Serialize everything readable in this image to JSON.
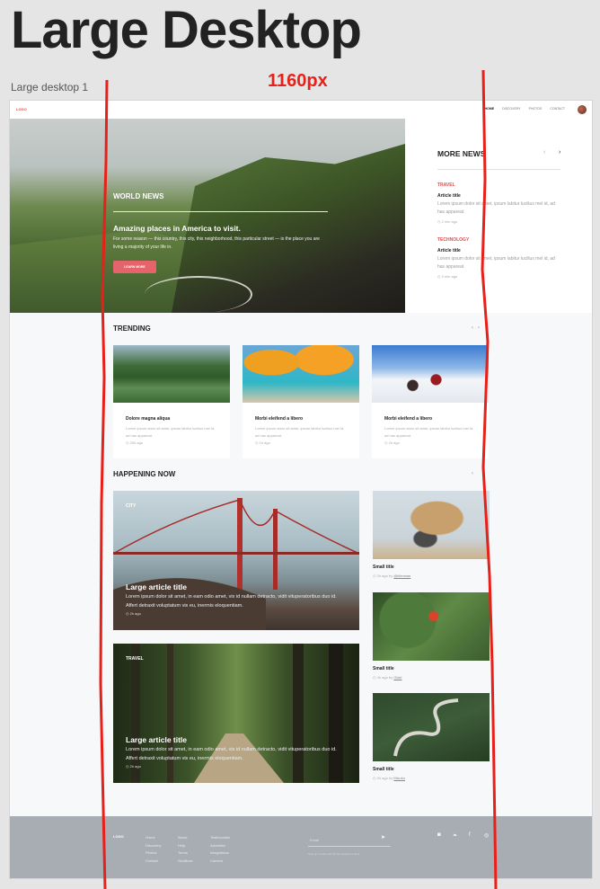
{
  "header": {
    "title": "Large Desktop",
    "frame_label": "Large desktop 1",
    "width_label": "1160px"
  },
  "colors": {
    "accent": "#e5636b",
    "annotation": "#e8201a",
    "footer_bg": "#a8adb4"
  },
  "nav": {
    "logo": "LOGO",
    "links": [
      "HOME",
      "DISCOVERY",
      "PHOTOS",
      "CONTACT"
    ],
    "active": "HOME"
  },
  "hero": {
    "label": "WORLD NEWS",
    "title": "Amazing places in America to visit.",
    "text": "For some reason — this country, this city, this neighborhood, this particular street — is the place you are living a majority of your life in.",
    "button": "LEARN MORE"
  },
  "more_news": {
    "title": "MORE NEWS",
    "items": [
      {
        "category": "TRAVEL",
        "title": "Article title",
        "text": "Lorem ipsum dolor sit amet, ipsum labitur lucilius mel id, ad has appareat.",
        "time": "2 min ago"
      },
      {
        "category": "TECHNOLOGY",
        "title": "Article title",
        "text": "Lorem ipsum dolor sit amet, ipsum labitur lucilius mel id, ad has appareat.",
        "time": "2 min ago"
      }
    ]
  },
  "trending": {
    "title": "TRENDING",
    "cards": [
      {
        "title": "Dolore magna aliqua",
        "text": "Lorem ipsum dolor sit amet, ipsum labitur lucilius mel id, ad has appareat.",
        "time": "20h ago"
      },
      {
        "title": "Morbi eleifend a libero",
        "text": "Lorem ipsum dolor sit amet, ipsum labitur lucilius mel id, ad has appareat.",
        "time": "1h ago"
      },
      {
        "title": "Morbi eleifend a libero",
        "text": "Lorem ipsum dolor sit amet, ipsum labitur lucilius mel id, ad has appareat.",
        "time": "2h ago"
      }
    ]
  },
  "happening": {
    "title": "HAPPENING NOW",
    "large": [
      {
        "category": "CITY",
        "title": "Large article title",
        "text": "Lorem ipsum dolor sit amet, in eam odio amet, vix id nullam detracto, vidit vituperatoribus duo id. Affert detraxit voluptatum vis eu, inermis eloquentiam.",
        "time": "2h ago"
      },
      {
        "category": "TRAVEL",
        "title": "Large article title",
        "text": "Lorem ipsum dolor sit amet, in eam odio amet, vix id nullam detracto, vidit vituperatoribus duo id. Affert detraxit voluptatum vis eu, inermis eloquentiam.",
        "time": "2h ago"
      }
    ],
    "small": [
      {
        "title": "Small title",
        "meta": "2h ago by",
        "author": "@kiterwan"
      },
      {
        "title": "Small title",
        "meta": "4h ago by",
        "author": "Glazi"
      },
      {
        "title": "Small title",
        "meta": "2h ago by",
        "author": "Misuko"
      }
    ]
  },
  "footer": {
    "logo": "LOGO",
    "col1": [
      "Home",
      "Discovery",
      "Photos",
      "Contact"
    ],
    "col2": [
      "About",
      "Help",
      "Terms",
      "Guidlines"
    ],
    "col3": [
      "Testimonials",
      "Advertise",
      "Integrations",
      "Careers"
    ],
    "email_placeholder": "Email",
    "note": "Stay up to date with all the freshest content.",
    "social_icons": [
      "instagram-icon",
      "twitter-icon",
      "facebook-icon",
      "dribbble-icon"
    ]
  }
}
